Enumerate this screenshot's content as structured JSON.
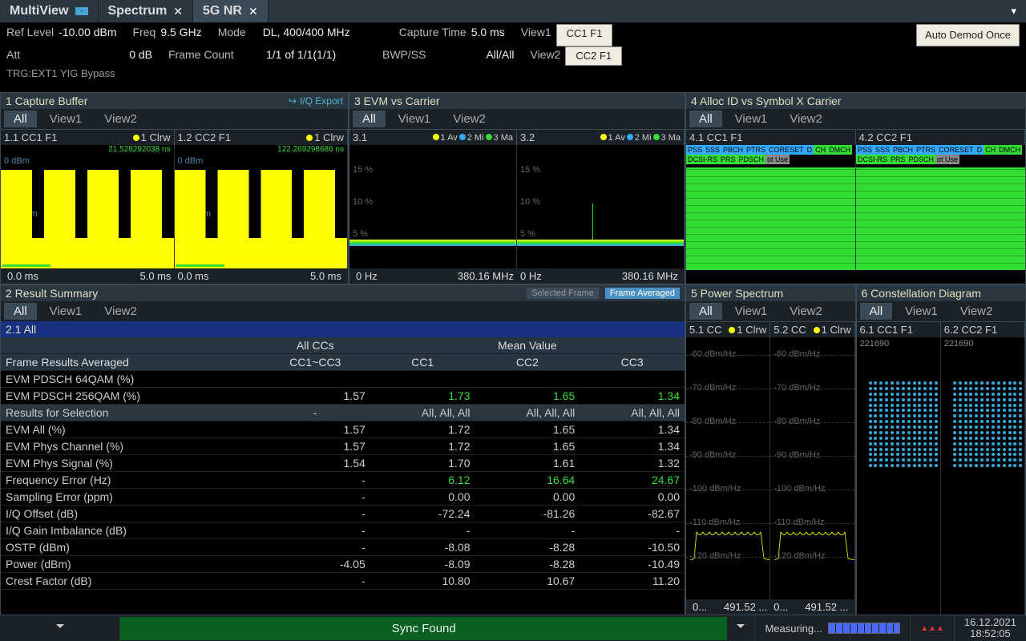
{
  "tabs": {
    "multiview": "MultiView",
    "spectrum": "Spectrum",
    "nr": "5G NR"
  },
  "params": {
    "ref_level_l": "Ref Level",
    "ref_level_v": "-10.00 dBm",
    "freq_l": "Freq",
    "freq_v": "9.5 GHz",
    "mode_l": "Mode",
    "mode_v": "DL, 400/400 MHz",
    "capture_l": "Capture Time",
    "capture_v": "5.0 ms",
    "att_l": "Att",
    "att_v": "0 dB",
    "frame_count_l": "Frame Count",
    "frame_count_v": "1/1 of 1/1(1/1)",
    "bwp_l": "BWP/SS",
    "bwp_v": "All/All",
    "view1_l": "View1",
    "view1_v": "CC1 F1",
    "view2_l": "View2",
    "view2_v": "CC2 F1",
    "auto_demod": "Auto Demod Once",
    "trg": "TRG:EXT1 YIG Bypass"
  },
  "pane1": {
    "title": "1 Capture Buffer",
    "export": "I/Q Export",
    "tabs": {
      "all": "All",
      "v1": "View1",
      "v2": "View2"
    },
    "sub1": "1.1 CC1 F1",
    "sub2": "1.2 CC2 F1",
    "trace": "1 Clrw",
    "marker1": "21.528292038 ns",
    "marker2": "122.269298686 ns",
    "ylabel1": "0 dBm",
    "ylabel2": "-50 dBm",
    "x0": "0.0 ms",
    "x1": "5.0 ms"
  },
  "pane3": {
    "title": "3 EVM vs Carrier",
    "tabs": {
      "all": "All",
      "v1": "View1",
      "v2": "View2"
    },
    "sub1": "3.1",
    "sub2": "3.2",
    "t1": "1 Av",
    "t2": "2 Mi",
    "t3": "3 Ma",
    "y15": "15 %",
    "y10": "10 %",
    "y5": "5 %",
    "x0": "0 Hz",
    "x1": "380.16 MHz"
  },
  "pane4": {
    "title": "4 Alloc ID vs Symbol X Carrier",
    "tabs": {
      "all": "All",
      "v1": "View1",
      "v2": "View2"
    },
    "sub1": "4.1 CC1 F1",
    "sub2": "4.2 CC2 F1",
    "chips": [
      "PSS",
      "SSS",
      "PBCH",
      "PTRS",
      "CORESET",
      "D",
      "CH",
      "DMCH",
      "DCSI-RS",
      "PRS",
      "PDSCH",
      "ot Use"
    ]
  },
  "pane2": {
    "title": "2 Result Summary",
    "sel": "Selected Frame",
    "avg": "Frame Averaged",
    "tabs": {
      "all": "All",
      "v1": "View1",
      "v2": "View2"
    },
    "subtitle": "2.1 All",
    "col_allcc": "All CCs",
    "col_mean": "Mean Value",
    "col_h1": "Frame Results Averaged",
    "col_h2": "CC1~CC3",
    "col_c1": "CC1",
    "col_c2": "CC2",
    "col_c3": "CC3",
    "rows": [
      {
        "l": "EVM PDSCH 64QAM (%)",
        "a": "",
        "c1": "",
        "c2": "",
        "c3": ""
      },
      {
        "l": "EVM PDSCH 256QAM (%)",
        "a": "1.57",
        "c1": "1.73",
        "c2": "1.65",
        "c3": "1.34",
        "g": true
      }
    ],
    "sel_row": {
      "l": "Results for Selection",
      "a": "-",
      "c1": "All, All, All",
      "c2": "All, All, All",
      "c3": "All, All, All"
    },
    "rows2": [
      {
        "l": "EVM All (%)",
        "a": "1.57",
        "c1": "1.72",
        "c2": "1.65",
        "c3": "1.34"
      },
      {
        "l": "EVM Phys Channel (%)",
        "a": "1.57",
        "c1": "1.72",
        "c2": "1.65",
        "c3": "1.34"
      },
      {
        "l": "EVM Phys Signal (%)",
        "a": "1.54",
        "c1": "1.70",
        "c2": "1.61",
        "c3": "1.32"
      },
      {
        "l": "Frequency Error (Hz)",
        "a": "-",
        "c1": "6.12",
        "c2": "16.64",
        "c3": "24.67",
        "g": true
      },
      {
        "l": "Sampling Error (ppm)",
        "a": "-",
        "c1": "0.00",
        "c2": "0.00",
        "c3": "0.00"
      },
      {
        "l": "I/Q Offset (dB)",
        "a": "-",
        "c1": "-72.24",
        "c2": "-81.26",
        "c3": "-82.67"
      },
      {
        "l": "I/Q Gain Imbalance (dB)",
        "a": "-",
        "c1": "-",
        "c2": "-",
        "c3": "-"
      },
      {
        "l": "OSTP (dBm)",
        "a": "-",
        "c1": "-8.08",
        "c2": "-8.28",
        "c3": "-10.50"
      },
      {
        "l": "Power (dBm)",
        "a": "-4.05",
        "c1": "-8.09",
        "c2": "-8.28",
        "c3": "-10.49"
      },
      {
        "l": "Crest Factor (dB)",
        "a": "-",
        "c1": "10.80",
        "c2": "10.67",
        "c3": "11.20"
      }
    ]
  },
  "pane5": {
    "title": "5 Power Spectrum",
    "tabs": {
      "all": "All",
      "v1": "View1",
      "v2": "View2"
    },
    "sub1": "5.1 CC",
    "sub2": "5.2 CC",
    "trace": "1 Clrw",
    "ylabels": [
      "-60 dBm/Hz",
      "-70 dBm/Hz",
      "-80 dBm/Hz",
      "-90 dBm/Hz",
      "-100 dBm/Hz",
      "-110 dBm/Hz",
      "-120 dBm/Hz"
    ],
    "x0": "0...",
    "x1": "491.52 ..."
  },
  "pane6": {
    "title": "6 Constellation Diagram",
    "tabs": {
      "all": "All",
      "v1": "View1",
      "v2": "View2"
    },
    "sub1": "6.1 CC1 F1",
    "sub2": "6.2 CC2 F1",
    "count": "221690"
  },
  "status": {
    "sync": "Sync Found",
    "measuring": "Measuring...",
    "date": "16.12.2021",
    "time": "18:52:05"
  }
}
